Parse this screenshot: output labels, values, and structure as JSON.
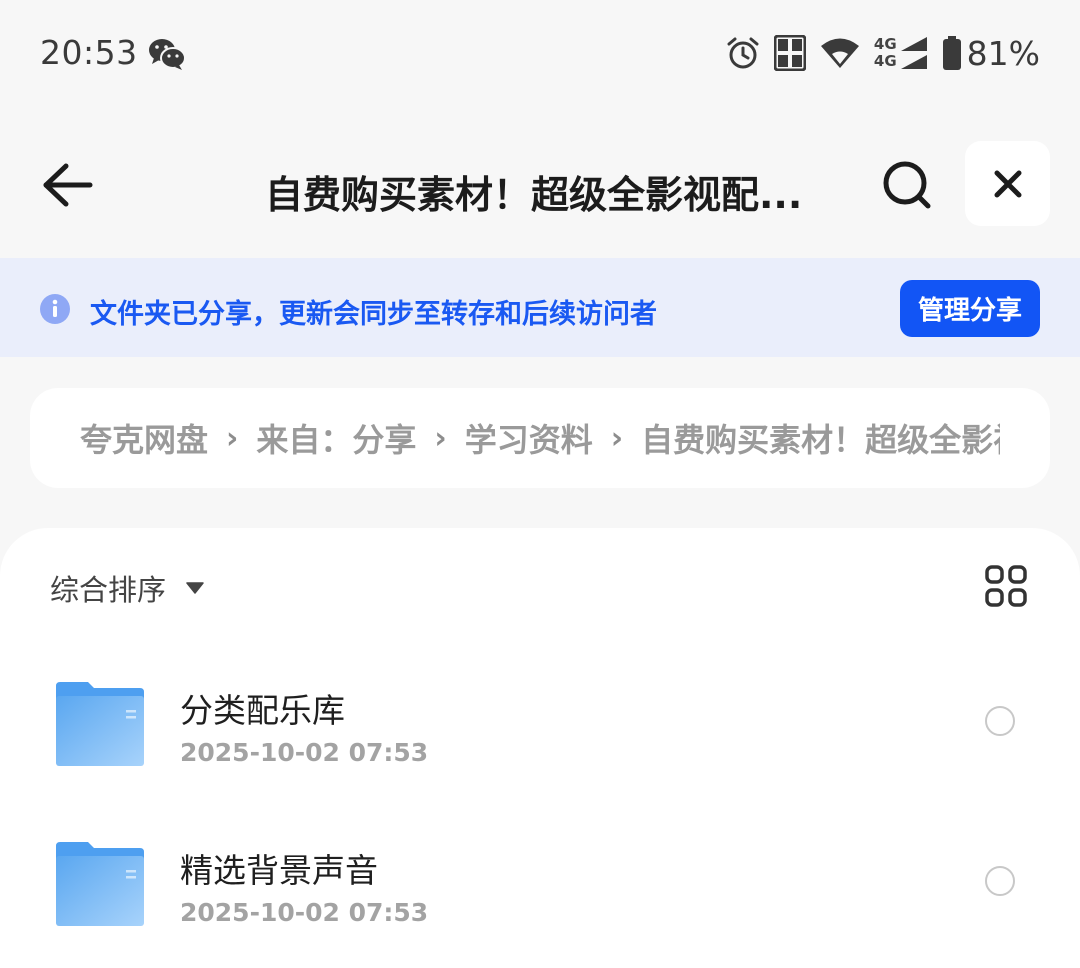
{
  "status_bar": {
    "time": "20:53",
    "battery_percent": "81%",
    "network_top": "4G",
    "network_bottom": "4G",
    "icons": [
      "wechat-icon",
      "alarm-icon",
      "hd-icon",
      "wifi-icon",
      "cell-signal-icon",
      "battery-icon"
    ]
  },
  "header": {
    "title": "自费购买素材！超级全影视配...",
    "icons": [
      "back-arrow-icon",
      "search-icon",
      "close-icon"
    ]
  },
  "share_banner": {
    "text": "文件夹已分享，更新会同步至转存和后续访问者",
    "button_label": "管理分享",
    "icon": "info-icon"
  },
  "breadcrumb": {
    "items": [
      "夸克网盘",
      "来自：分享",
      "学习资料",
      "自费购买素材！超级全影视配乐"
    ],
    "separator": "›"
  },
  "toolbar": {
    "sort_label": "综合排序",
    "icons": [
      "caret-down-icon",
      "grid-view-icon"
    ]
  },
  "files": [
    {
      "name": "分类配乐库",
      "date": "2025-10-02 07:53",
      "type": "folder"
    },
    {
      "name": "精选背景声音",
      "date": "2025-10-02 07:53",
      "type": "folder"
    }
  ],
  "colors": {
    "accent": "#1255f5",
    "banner_bg": "#eaeefb",
    "banner_text": "#1a59f2",
    "folder": "#6cb3f3",
    "page_bg": "#f7f7f7"
  }
}
